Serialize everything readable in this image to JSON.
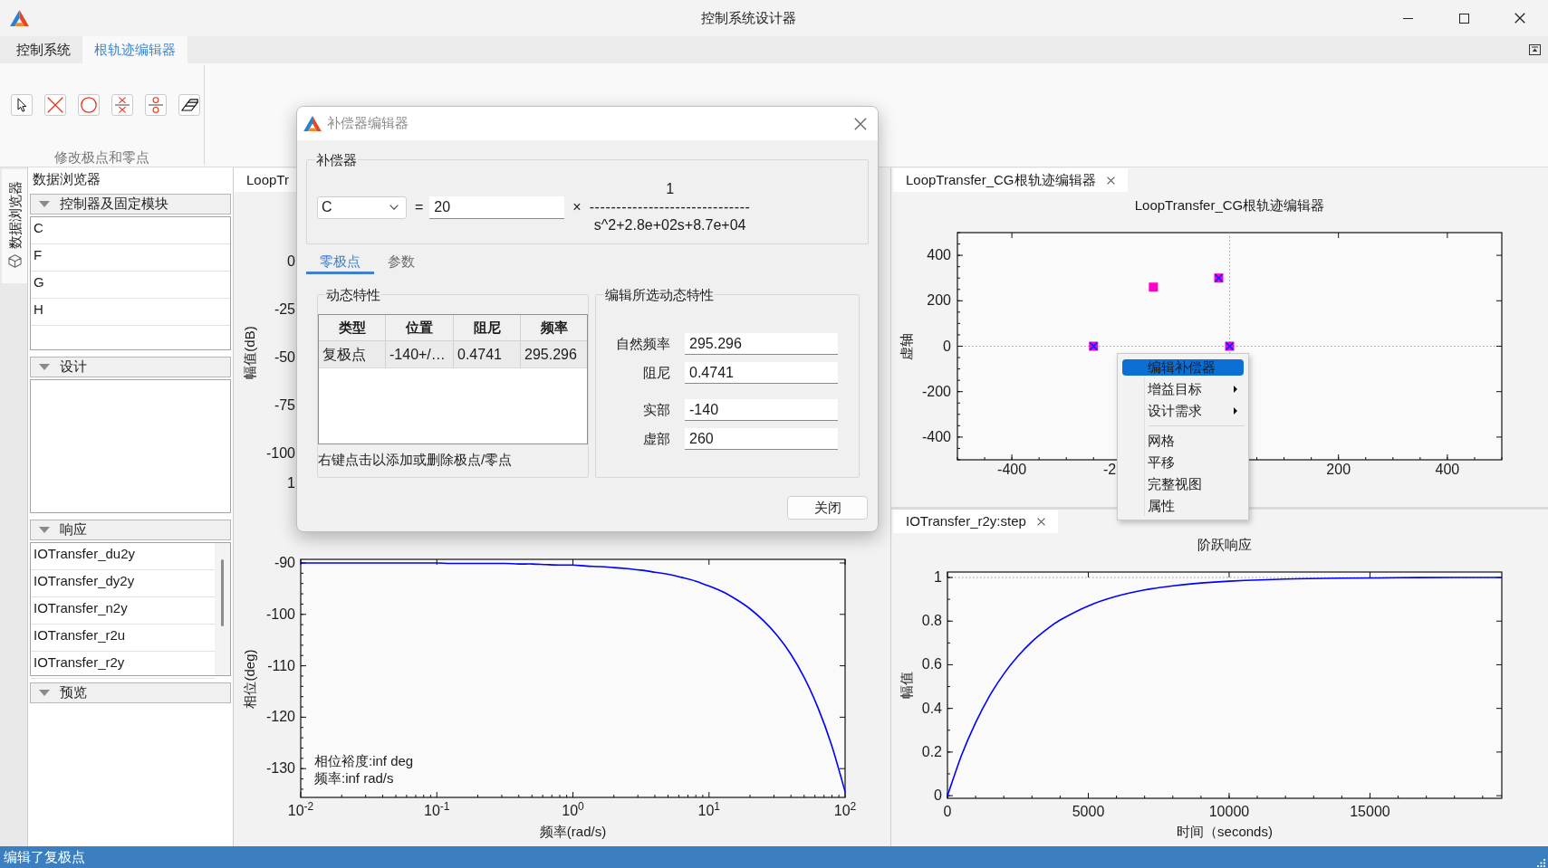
{
  "window": {
    "title": "控制系统设计器"
  },
  "tabs": [
    {
      "label": "控制系统",
      "selected": false
    },
    {
      "label": "根轨迹编辑器",
      "selected": true
    }
  ],
  "ribbon": {
    "group_label": "修改极点和零点"
  },
  "side_tabs": [
    {
      "label": "数据浏览器",
      "selected": true
    }
  ],
  "data_browser": {
    "title": "数据浏览器",
    "sections": [
      {
        "title": "控制器及固定模块",
        "expanded": true,
        "items": [
          "C",
          "F",
          "G",
          "H"
        ]
      },
      {
        "title": "设计",
        "expanded": true
      },
      {
        "title": "响应",
        "expanded": true,
        "items": [
          "IOTransfer_du2y",
          "IOTransfer_dy2y",
          "IOTransfer_n2y",
          "IOTransfer_r2u",
          "IOTransfer_r2y"
        ]
      },
      {
        "title": "预览",
        "expanded": true
      }
    ]
  },
  "center_panel": {
    "tab": "LoopTr",
    "magnitude_plot": {
      "ylabel": "幅值(dB)",
      "ytick_labels": [
        "0",
        "-25",
        "-50",
        "-75",
        "-100"
      ],
      "xtick_label": "1"
    },
    "phase_plot": {
      "chart_data": {
        "type": "line",
        "xlabel": "频率(rad/s)",
        "ylabel": "相位(deg)",
        "categories": [
          "10$^{-2}$",
          null,
          null,
          null,
          null,
          null,
          null,
          null,
          null,
          null,
          "10$^{-1}$",
          null,
          null,
          null,
          null,
          null,
          null,
          null,
          null,
          null,
          "10$^{0}$",
          null,
          null,
          null,
          null,
          null,
          null,
          null,
          null,
          null,
          "10$^{1}$",
          null,
          null,
          null,
          null,
          null,
          null,
          null,
          null,
          null,
          "10$^{2}$"
        ],
        "series": [
          {
            "color": "#0000ff",
            "values": [
              -90,
              -90,
              -90,
              -90,
              -90,
              -90,
              -90,
              -90,
              -90,
              -90,
              -90,
              -90.1,
              -90.1,
              -90.1,
              -90.1,
              -90.1,
              -90.2,
              -90.2,
              -90.3,
              -90.4,
              -90.4,
              -90.6,
              -90.7,
              -90.9,
              -91.1,
              -91.4,
              -91.8,
              -92.2,
              -92.8,
              -93.5,
              -94.5,
              -95.6,
              -97.1,
              -98.9,
              -101.2,
              -104.1,
              -107.7,
              -112.3,
              -118.1,
              -125.4,
              -134.5
            ]
          }
        ],
        "ylim": [
          -135.6,
          -89.3
        ],
        "yticks": [
          -90,
          -100,
          -110,
          -120,
          -130
        ],
        "annotations": [
          "相位裕度:inf deg",
          "频率:inf rad/s"
        ]
      }
    }
  },
  "dialog": {
    "title": "补偿器编辑器",
    "compensator": {
      "label": "补偿器",
      "selector": "C",
      "equals": "=",
      "gain": "20",
      "times": "×",
      "numerator": "1",
      "fraction_bar": "------------------------------",
      "denominator": "s^2+2.8e+02s+8.7e+04"
    },
    "tabs": [
      {
        "label": "零极点",
        "selected": true
      },
      {
        "label": "参数",
        "selected": false
      }
    ],
    "dynamics": {
      "label": "动态特性",
      "table": {
        "columns": [
          "类型",
          "位置",
          "阻尼",
          "频率"
        ],
        "rows": [
          {
            "cells": [
              "复极点",
              "-140+/…",
              "0.4741",
              "295.296"
            ],
            "selected": true
          }
        ]
      },
      "hint": "右键点击以添加或删除极点/零点"
    },
    "edit": {
      "label": "编辑所选动态特性",
      "field_groups": [
        {
          "fields": [
            {
              "label": "自然频率",
              "value": "295.296"
            },
            {
              "label": "阻尼",
              "value": "0.4741"
            }
          ]
        },
        {
          "fields": [
            {
              "label": "实部",
              "value": "-140"
            },
            {
              "label": "虚部",
              "value": "260"
            }
          ]
        }
      ]
    },
    "buttons": [
      "关闭"
    ]
  },
  "root_locus_panel": {
    "tab": "LoopTransfer_CG根轨迹编辑器",
    "chart_data": {
      "type": "scatter",
      "title": "LoopTransfer_CG根轨迹编辑器",
      "ylabel": "虚轴",
      "x": [
        -250,
        -140,
        -20,
        0
      ],
      "series": [
        {
          "color": "#ff00cc",
          "marker": "square",
          "values": [
            0,
            260,
            300,
            0
          ]
        },
        {
          "color": "#2020ff",
          "marker": "x",
          "values": [
            0,
            null,
            300,
            0
          ]
        }
      ],
      "xlim": [
        -500,
        500
      ],
      "ylim": [
        -500,
        500
      ],
      "xticks": [
        -400,
        200,
        400
      ],
      "yticks": [
        -400,
        -200,
        0,
        200,
        400
      ]
    },
    "cut_xtick_label": "-2"
  },
  "context_menu": {
    "groups": [
      {
        "items": [
          {
            "label": "编辑补偿器",
            "selected": true,
            "submenu": false
          },
          {
            "label": "增益目标",
            "selected": false,
            "submenu": true
          },
          {
            "label": "设计需求",
            "selected": false,
            "submenu": true
          }
        ]
      },
      {
        "items": [
          {
            "label": "网格",
            "selected": false,
            "submenu": false
          },
          {
            "label": "平移",
            "selected": false,
            "submenu": false
          },
          {
            "label": "完整视图",
            "selected": false,
            "submenu": false
          },
          {
            "label": "属性",
            "selected": false,
            "submenu": false
          }
        ]
      }
    ]
  },
  "step_panel": {
    "tab": "IOTransfer_r2y:step",
    "chart_data": {
      "type": "line",
      "title": "阶跃响应",
      "xlabel": "时间（seconds)",
      "ylabel": "幅值",
      "x": [
        0,
        500,
        1000,
        1500,
        2000,
        2500,
        3000,
        3500,
        4000,
        5000,
        6000,
        7000,
        8000,
        9000,
        10000,
        12000,
        14000,
        16000,
        18000,
        19680
      ],
      "series": [
        {
          "color": "#0000ff",
          "values": [
            0,
            0.185,
            0.335,
            0.458,
            0.558,
            0.639,
            0.706,
            0.76,
            0.805,
            0.87,
            0.914,
            0.943,
            0.962,
            0.975,
            0.983,
            0.993,
            0.997,
            0.999,
            1,
            1
          ]
        }
      ],
      "xlim": [
        0,
        19680
      ],
      "ylim": [
        -0.012,
        1.025
      ],
      "xticks": [
        0,
        5000,
        10000,
        15000
      ],
      "yticks": [
        0,
        0.2,
        0.4,
        0.6,
        0.8,
        1
      ]
    }
  },
  "status_bar": {
    "text": "编辑了复极点"
  }
}
